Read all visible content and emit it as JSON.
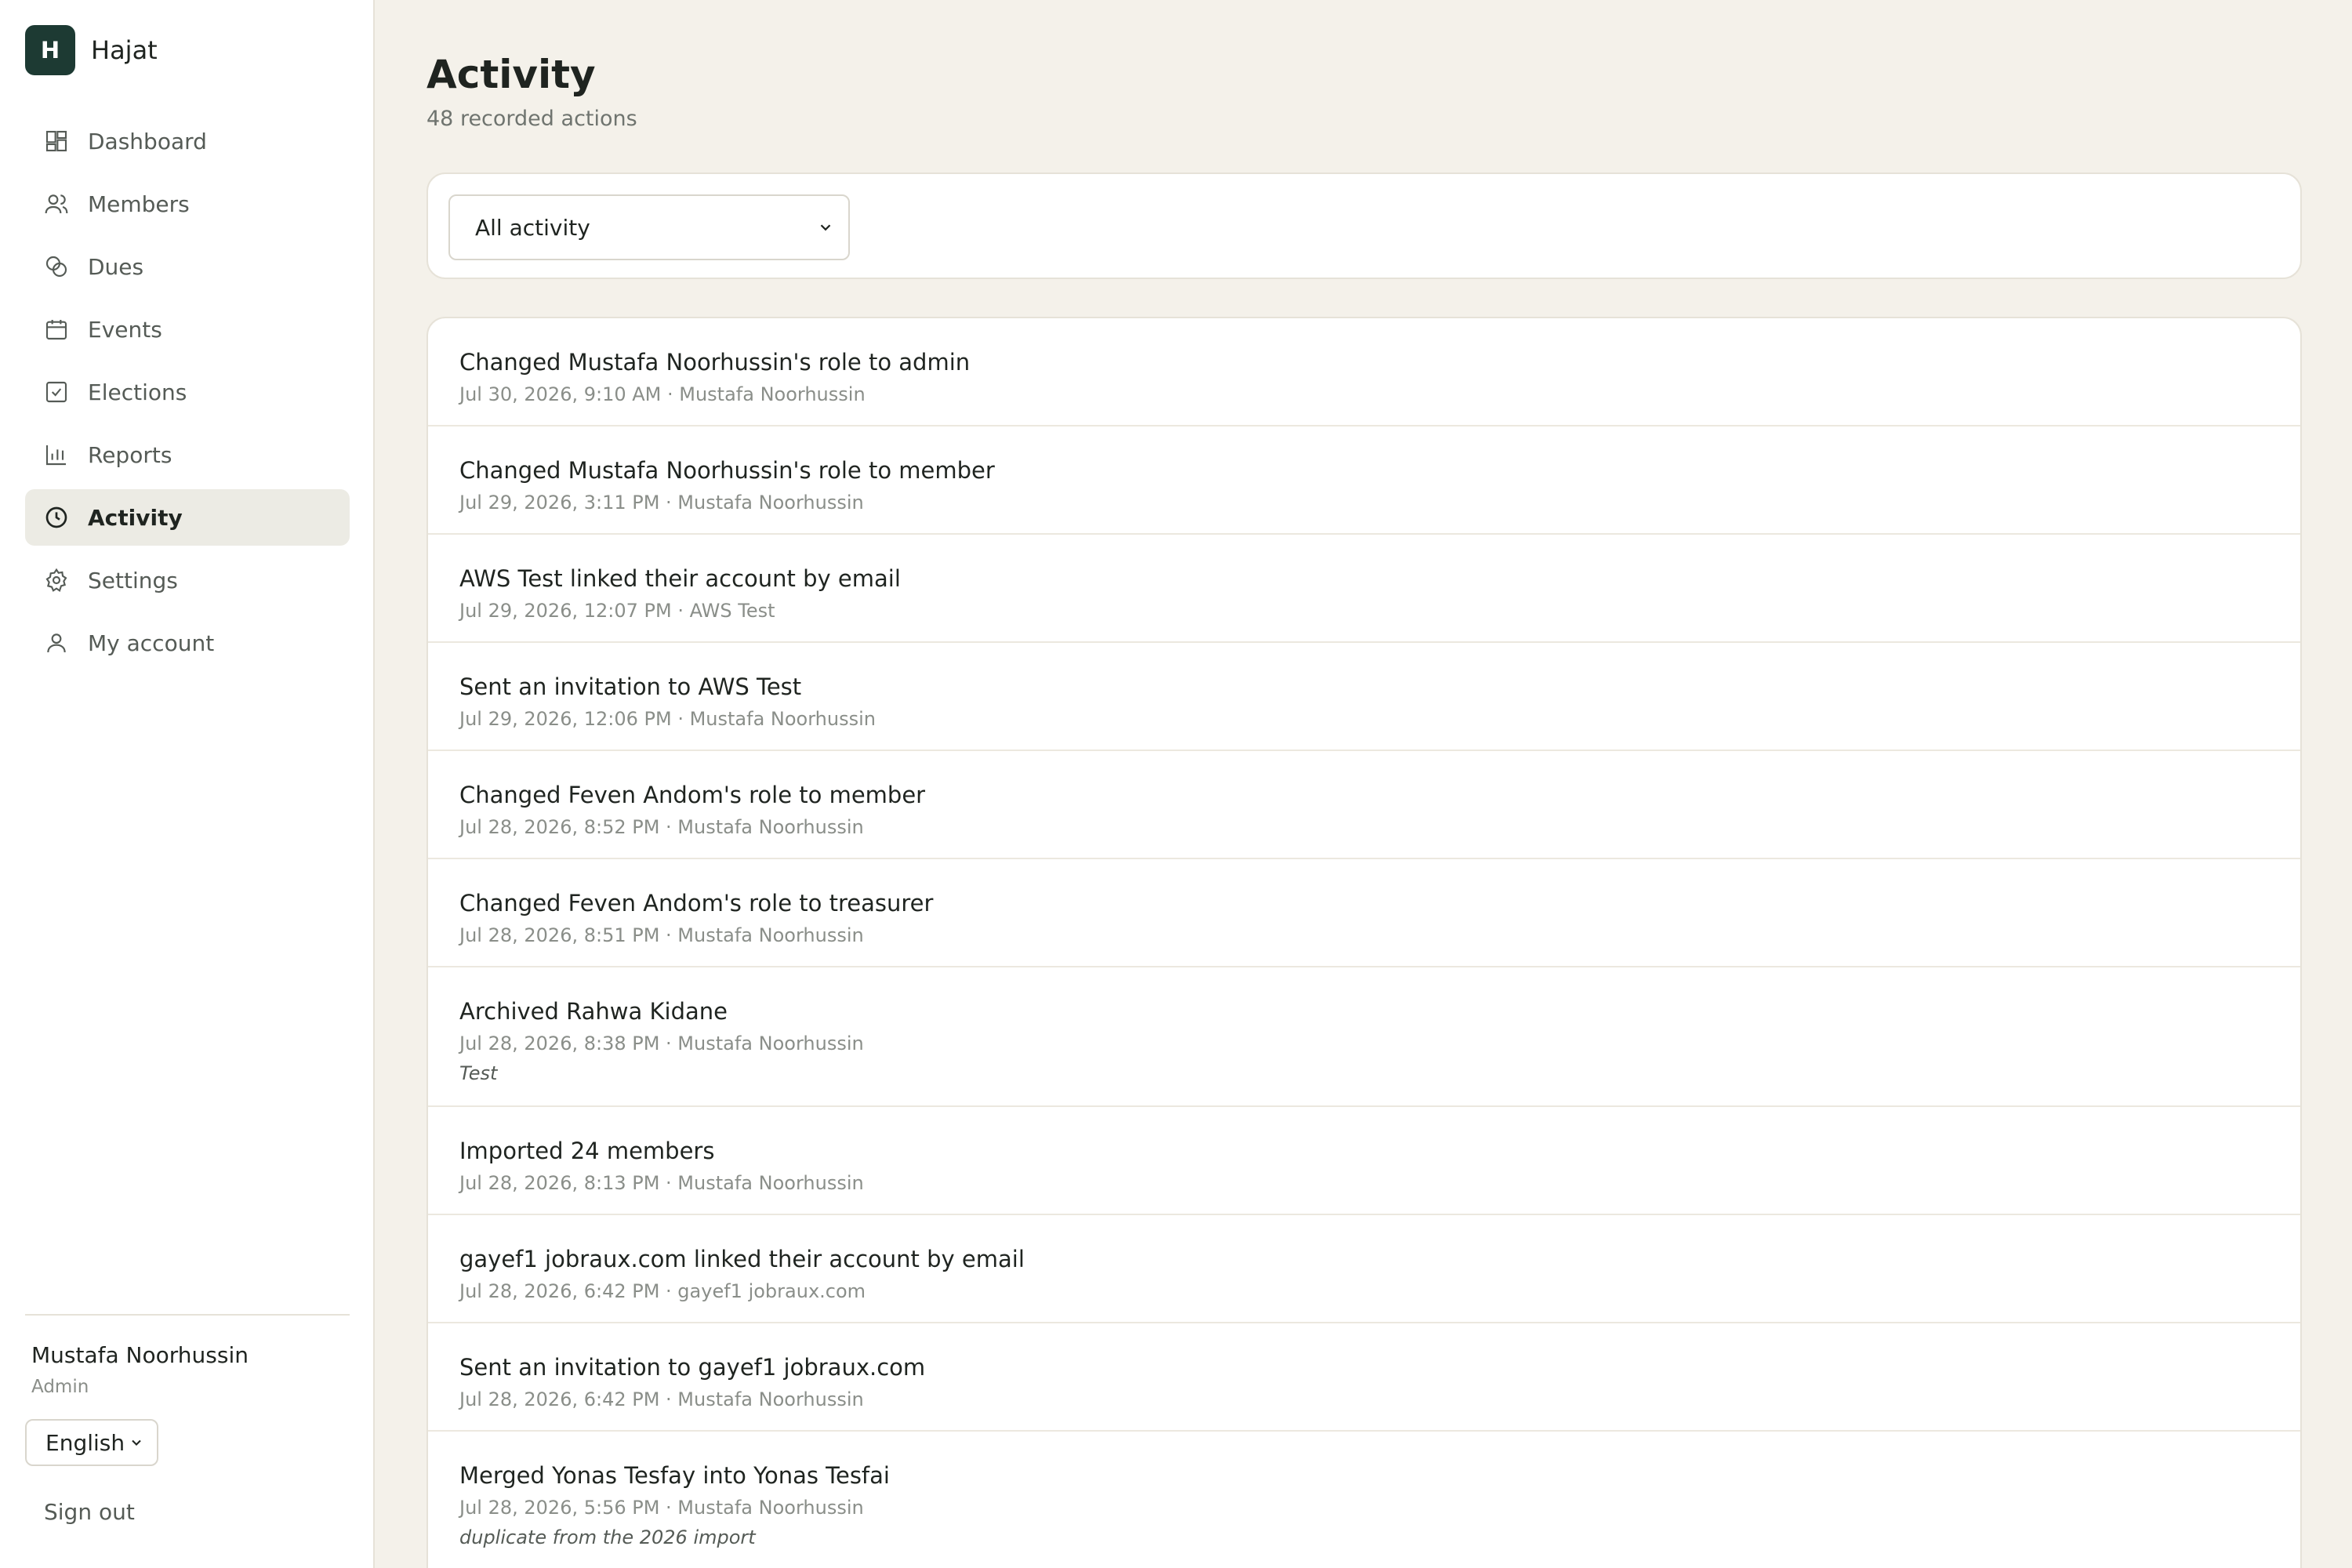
{
  "brand": {
    "initial": "H",
    "name": "Hajat"
  },
  "nav": {
    "items": [
      {
        "label": "Dashboard",
        "icon": "dashboard-icon"
      },
      {
        "label": "Members",
        "icon": "members-icon"
      },
      {
        "label": "Dues",
        "icon": "dues-icon"
      },
      {
        "label": "Events",
        "icon": "calendar-icon"
      },
      {
        "label": "Elections",
        "icon": "checkbox-icon"
      },
      {
        "label": "Reports",
        "icon": "bar-chart-icon"
      },
      {
        "label": "Activity",
        "icon": "clock-icon",
        "active": true
      },
      {
        "label": "Settings",
        "icon": "gear-icon"
      },
      {
        "label": "My account",
        "icon": "user-icon"
      }
    ]
  },
  "user": {
    "name": "Mustafa Noorhussin",
    "role": "Admin"
  },
  "language": {
    "selected": "English"
  },
  "signout_label": "Sign out",
  "page": {
    "title": "Activity",
    "subtitle": "48 recorded actions"
  },
  "filter": {
    "selected": "All activity"
  },
  "activities": [
    {
      "title": "Changed Mustafa Noorhussin's role to admin",
      "meta": "Jul 30, 2026, 9:10 AM · Mustafa Noorhussin"
    },
    {
      "title": "Changed Mustafa Noorhussin's role to member",
      "meta": "Jul 29, 2026, 3:11 PM · Mustafa Noorhussin"
    },
    {
      "title": "AWS Test linked their account by email",
      "meta": "Jul 29, 2026, 12:07 PM · AWS Test"
    },
    {
      "title": "Sent an invitation to AWS Test",
      "meta": "Jul 29, 2026, 12:06 PM · Mustafa Noorhussin"
    },
    {
      "title": "Changed Feven Andom's role to member",
      "meta": "Jul 28, 2026, 8:52 PM · Mustafa Noorhussin"
    },
    {
      "title": "Changed Feven Andom's role to treasurer",
      "meta": "Jul 28, 2026, 8:51 PM · Mustafa Noorhussin"
    },
    {
      "title": "Archived Rahwa Kidane",
      "meta": "Jul 28, 2026, 8:38 PM · Mustafa Noorhussin",
      "note": "Test"
    },
    {
      "title": "Imported 24 members",
      "meta": "Jul 28, 2026, 8:13 PM · Mustafa Noorhussin"
    },
    {
      "title": "gayef1 jobraux.com linked their account by email",
      "meta": "Jul 28, 2026, 6:42 PM · gayef1 jobraux.com"
    },
    {
      "title": "Sent an invitation to gayef1 jobraux.com",
      "meta": "Jul 28, 2026, 6:42 PM · Mustafa Noorhussin"
    },
    {
      "title": "Merged Yonas Tesfay into Yonas Tesfai",
      "meta": "Jul 28, 2026, 5:56 PM · Mustafa Noorhussin",
      "note": "duplicate from the 2026 import"
    }
  ],
  "colors": {
    "background": "#f4f1ea",
    "brand": "#1d3a33",
    "active_nav": "#ecebe4",
    "border": "#e6e2d8"
  }
}
